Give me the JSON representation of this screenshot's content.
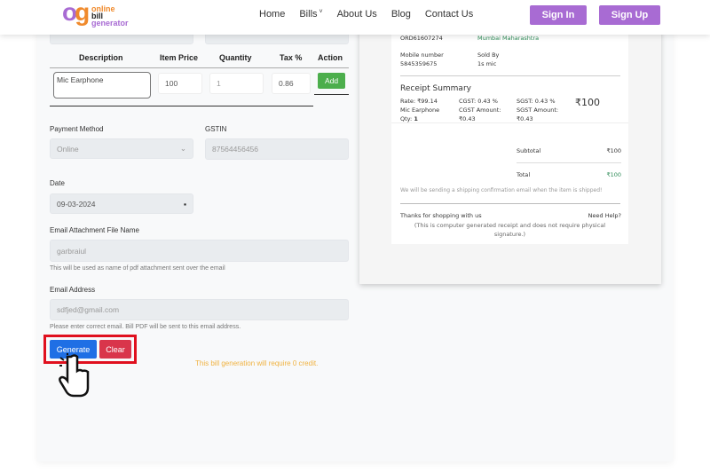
{
  "nav": {
    "logo": {
      "mark": "og",
      "line1": "online",
      "line2": "bill",
      "line3": "generator"
    },
    "links": [
      "Home",
      "Bills",
      "About Us",
      "Blog",
      "Contact Us"
    ],
    "sign_in": "Sign In",
    "sign_up": "Sign Up"
  },
  "table": {
    "headers": [
      "Description",
      "Item Price",
      "Quantity",
      "Tax %",
      "Action"
    ],
    "row": {
      "description": "Mic Earphone",
      "price": "100",
      "quantity": "1",
      "tax": "0.86"
    },
    "add": "Add"
  },
  "form": {
    "payment_label": "Payment Method",
    "payment_value": "Online",
    "gstin_label": "GSTIN",
    "gstin_value": "87564456456",
    "date_label": "Date",
    "date_value": "09-03-2024",
    "file_label": "Email Attachment File Name",
    "file_value": "garbraiul",
    "file_help": "This will be used as name of pdf attachment sent over the email",
    "email_label": "Email Address",
    "email_value": "sdfjed@gmail.com",
    "email_help": "Please enter correct email. Bill PDF will be sent to this email address.",
    "generate": "Generate",
    "clear": "Clear",
    "credit_note": "This bill generation will require 0 credit."
  },
  "receipt": {
    "order_id": "ORD61607274",
    "location": "Mumbai Maharashtra",
    "mobile_label": "Mobile number",
    "mobile": "5845359675",
    "sold_by_label": "Sold By",
    "sold_by": "1s mic",
    "summary_title": "Receipt Summary",
    "rate": "Rate: ₹99.14",
    "item": "Mic Earphone",
    "qty_label": "Qty:",
    "qty": "1",
    "cgst": "CGST: 0.43 %",
    "cgst_amt_label": "CGST Amount:",
    "cgst_amt": "₹0.43",
    "sgst": "SGST: 0.43 %",
    "sgst_amt_label": "SGST Amount:",
    "sgst_amt": "₹0.43",
    "amount": "₹100",
    "subtotal_label": "Subtotal",
    "subtotal": "₹100",
    "total_label": "Total",
    "total": "₹100",
    "shipping_note": "We will be sending a shipping confirmation email when the item is shipped!",
    "thanks": "Thanks for shopping with us",
    "need_help": "Need Help?",
    "disclaimer": "(This is computer generated receipt and does not require physical signature.)"
  },
  "colors": {
    "accent": "#a86bd3",
    "add": "#4cae4c",
    "generate": "#1f6fe5",
    "clear": "#d9354b",
    "highlight": "#e0101e",
    "credit": "#f0b240",
    "green_text": "#2e8b57"
  }
}
